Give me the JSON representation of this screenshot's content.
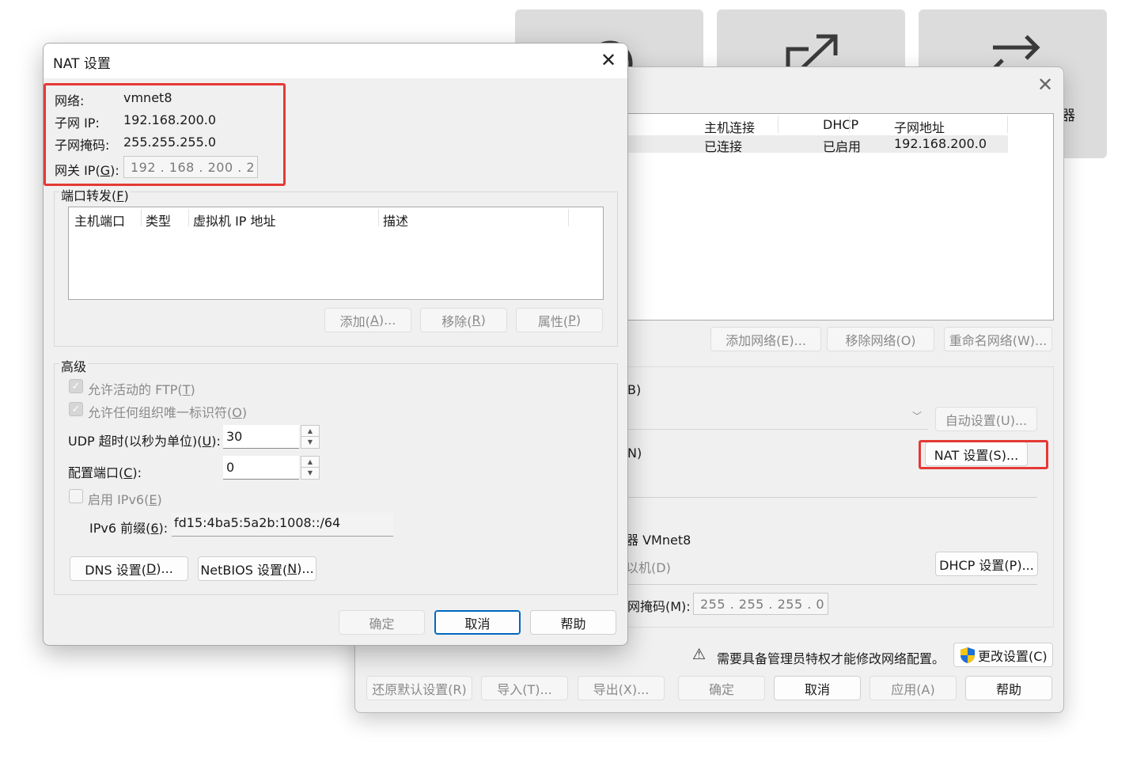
{
  "main_window": {
    "vnet_columns": [
      "主机连接",
      "DHCP",
      "子网地址"
    ],
    "vnet_row": {
      "host": "已连接",
      "dhcp": "已启用",
      "subnet": "192.168.200.0"
    },
    "buttons": {
      "add_network": "添加网络(E)...",
      "remove_network": "移除网络(O)",
      "rename_network": "重命名网络(W)...",
      "auto_settings": "自动设置(U)...",
      "nat_settings": "NAT 设置(S)...",
      "dhcp_settings": "DHCP 设置(P)...",
      "change_settings": "更改设置(C)",
      "restore_defaults": "还原默认设置(R)",
      "import": "导入(T)...",
      "export": "导出(X)...",
      "ok": "确定",
      "cancel": "取消",
      "apply": "应用(A)",
      "help": "帮助"
    },
    "partial_labels": {
      "b": "B)",
      "n": "N)",
      "adapter": "器 VMnet8",
      "vm": "以机(D)",
      "subnet_mask": "网掩码(M):",
      "tile_char": "器"
    },
    "subnet_mask_value": "255 . 255 . 255 .   0",
    "admin_notice": "需要具备管理员特权才能修改网络配置。"
  },
  "nat_dialog": {
    "title": "NAT 设置",
    "network_label": "网络:",
    "network_value": "vmnet8",
    "subnet_ip_label": "子网 IP:",
    "subnet_ip_value": "192.168.200.0",
    "subnet_mask_label": "子网掩码:",
    "subnet_mask_value": "255.255.255.0",
    "gateway_label_prefix": "网关 IP(",
    "gateway_label_key": "G",
    "gateway_label_suffix": "):",
    "gateway_value": "192 . 168 . 200 .   2",
    "port_forward": {
      "title_prefix": "端口转发(",
      "title_key": "F",
      "title_suffix": ")",
      "columns": [
        "主机端口",
        "类型",
        "虚拟机 IP 地址",
        "描述"
      ],
      "add_prefix": "添加(",
      "add_key": "A",
      "add_suffix": ")...",
      "remove_prefix": "移除(",
      "remove_key": "R",
      "remove_suffix": ")",
      "props_prefix": "属性(",
      "props_key": "P",
      "props_suffix": ")"
    },
    "advanced": {
      "title": "高级",
      "ftp_prefix": "允许活动的 FTP(",
      "ftp_key": "T",
      "ftp_suffix": ")",
      "uid_prefix": "允许任何组织唯一标识符(",
      "uid_key": "O",
      "uid_suffix": ")",
      "udp_prefix": "UDP 超时(以秒为单位)(",
      "udp_key": "U",
      "udp_suffix": "):",
      "udp_value": "30",
      "port_prefix": "配置端口(",
      "port_key": "C",
      "port_suffix": "):",
      "port_value": "0",
      "ipv6_prefix": "启用 IPv6(",
      "ipv6_key": "E",
      "ipv6_suffix": ")",
      "ipv6_prefix_label_prefix": "IPv6 前缀(",
      "ipv6_prefix_label_key": "6",
      "ipv6_prefix_label_suffix": "):",
      "ipv6_prefix_value": "fd15:4ba5:5a2b:1008::/64",
      "dns_prefix": "DNS 设置(",
      "dns_key": "D",
      "dns_suffix": ")...",
      "netbios_prefix": "NetBIOS 设置(",
      "netbios_key": "N",
      "netbios_suffix": ")..."
    },
    "ok": "确定",
    "cancel": "取消",
    "help": "帮助"
  }
}
